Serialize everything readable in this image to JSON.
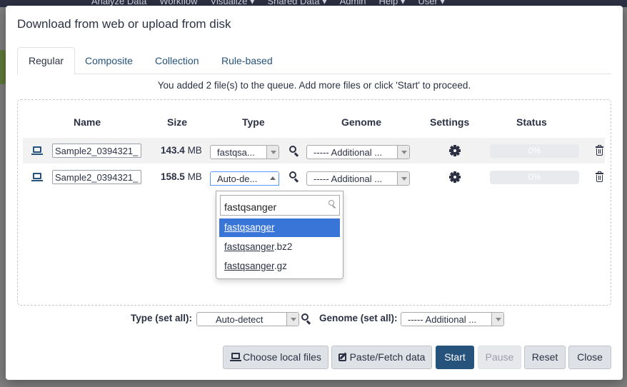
{
  "background": {
    "nav_items": [
      "Analyze Data",
      "Workflow",
      "Visualize ▾",
      "Shared Data ▾",
      "Admin",
      "Help ▾",
      "User ▾"
    ]
  },
  "modal": {
    "title": "Download from web or upload from disk",
    "tabs": [
      {
        "label": "Regular",
        "active": true
      },
      {
        "label": "Composite",
        "active": false
      },
      {
        "label": "Collection",
        "active": false
      },
      {
        "label": "Rule-based",
        "active": false
      }
    ],
    "info_text": "You added 2 file(s) to the queue. Add more files or click 'Start' to proceed."
  },
  "table": {
    "headers": {
      "name": "Name",
      "size": "Size",
      "type": "Type",
      "genome": "Genome",
      "settings": "Settings",
      "status": "Status"
    },
    "rows": [
      {
        "name": "Sample2_0394321_",
        "size_value": "143.4",
        "size_unit": "MB",
        "type": "fastqsa...",
        "genome": "----- Additional ...",
        "status": "0%",
        "progress": 0
      },
      {
        "name": "Sample2_0394321_",
        "size_value": "158.5",
        "size_unit": "MB",
        "type": "Auto-de...",
        "genome": "----- Additional ...",
        "status": "0%",
        "progress": 0
      }
    ]
  },
  "type_dropdown": {
    "search_value": "fastqsanger",
    "options": [
      {
        "match": "fastqsanger",
        "rest": "",
        "highlighted": true
      },
      {
        "match": "fastqsanger",
        "rest": ".bz2",
        "highlighted": false
      },
      {
        "match": "fastqsanger",
        "rest": ".gz",
        "highlighted": false
      }
    ]
  },
  "footer": {
    "type_set_all_label": "Type (set all):",
    "type_set_all_value": "Auto-detect",
    "genome_set_all_label": "Genome (set all):",
    "genome_set_all_value": "----- Additional ...",
    "buttons": {
      "choose_local": "Choose local files",
      "paste_fetch": "Paste/Fetch data",
      "start": "Start",
      "pause": "Pause",
      "reset": "Reset",
      "close": "Close"
    }
  },
  "colors": {
    "primary": "#25537b",
    "highlight": "#3875d7",
    "text": "#2c3143"
  },
  "icons": {
    "row_source": "laptop-icon",
    "type_search": "search-icon",
    "settings": "gear-icon",
    "delete": "trash-icon",
    "choose_local": "laptop-icon",
    "paste_fetch": "edit-icon"
  }
}
